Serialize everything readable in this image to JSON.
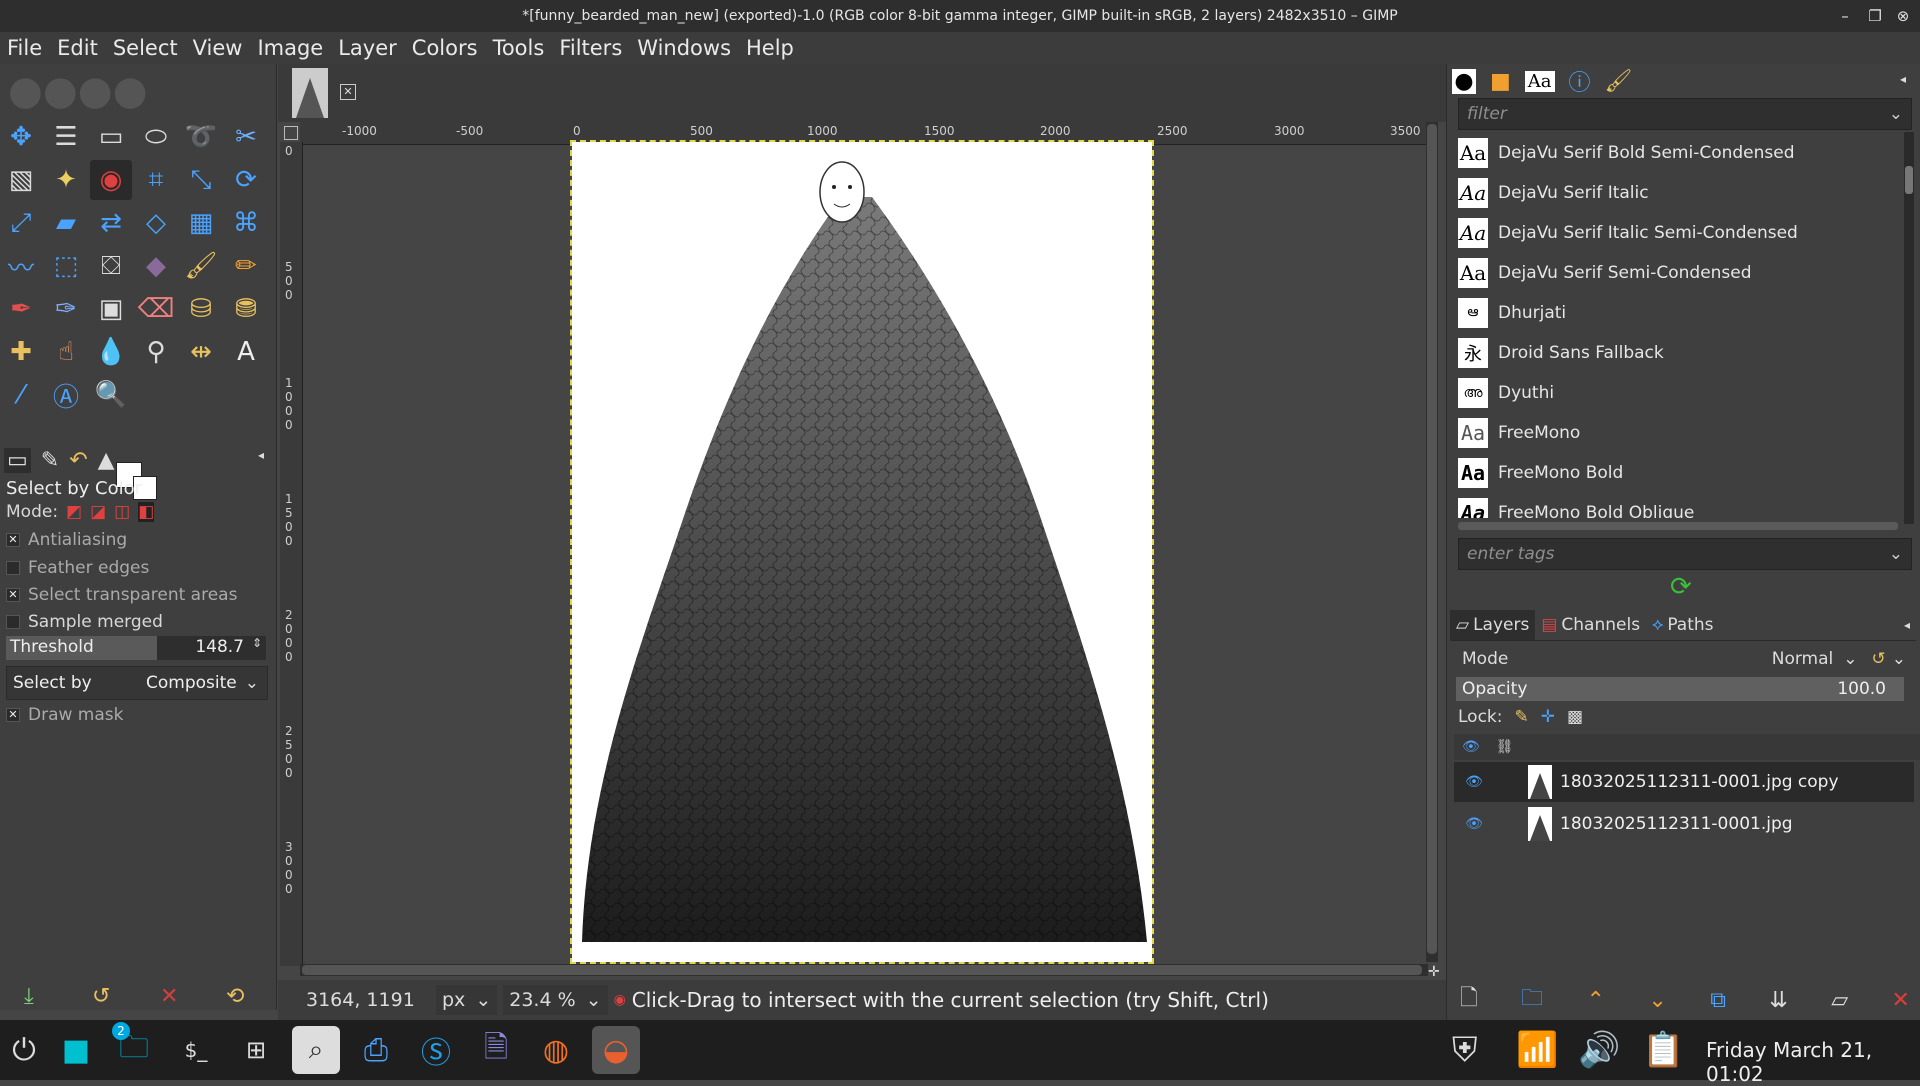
{
  "window": {
    "title": "*[funny_bearded_man_new] (exported)-1.0 (RGB color 8-bit gamma integer, GIMP built-in sRGB, 2 layers) 2482x3510 – GIMP"
  },
  "menu": [
    "File",
    "Edit",
    "Select",
    "View",
    "Image",
    "Layer",
    "Colors",
    "Tools",
    "Filters",
    "Windows",
    "Help"
  ],
  "tool_options": {
    "title": "Select by Color",
    "mode_label": "Mode:",
    "antialiasing": "Antialiasing",
    "feather": "Feather edges",
    "transparent": "Select transparent areas",
    "sample_merged": "Sample merged",
    "threshold_label": "Threshold",
    "threshold_value": "148.7",
    "threshold_fraction": 0.58,
    "select_by_label": "Select by",
    "select_by_value": "Composite",
    "draw_mask": "Draw mask"
  },
  "rulers": {
    "h": [
      "-1000",
      "-500",
      "0",
      "500",
      "1000",
      "1500",
      "2000",
      "2500",
      "3000",
      "3500"
    ],
    "v": [
      "0",
      "500",
      "1000",
      "1500",
      "2000",
      "2500",
      "3000"
    ]
  },
  "status": {
    "coords": "3164, 1191",
    "unit": "px",
    "zoom": "23.4 %",
    "message": "Click-Drag to intersect with the current selection (try Shift, Ctrl)"
  },
  "fonts": {
    "filter_placeholder": "filter",
    "tags_placeholder": "enter tags",
    "items": [
      {
        "name": "DejaVu Serif Bold Semi-Condensed",
        "preview": "Aa"
      },
      {
        "name": "DejaVu Serif Italic",
        "preview": "Aa"
      },
      {
        "name": "DejaVu Serif Italic Semi-Condensed",
        "preview": "Aa"
      },
      {
        "name": "DejaVu Serif Semi-Condensed",
        "preview": "Aa"
      },
      {
        "name": "Dhurjati",
        "preview": "ఆ"
      },
      {
        "name": "Droid Sans Fallback",
        "preview": "永"
      },
      {
        "name": "Dyuthi",
        "preview": "അ"
      },
      {
        "name": "FreeMono",
        "preview": "Aa"
      },
      {
        "name": "FreeMono Bold",
        "preview": "Aa"
      },
      {
        "name": "FreeMono Bold Oblique",
        "preview": "Aa"
      }
    ]
  },
  "layers_panel": {
    "tabs": [
      "Layers",
      "Channels",
      "Paths"
    ],
    "mode_label": "Mode",
    "mode_value": "Normal",
    "opacity_label": "Opacity",
    "opacity_value": "100.0",
    "lock_label": "Lock:",
    "layers": [
      {
        "name": "18032025112311-0001.jpg copy",
        "selected": true
      },
      {
        "name": "18032025112311-0001.jpg",
        "selected": false
      }
    ]
  },
  "taskbar": {
    "clock": "Friday March 21, 01:02",
    "files_badge": "2",
    "icons": [
      "menu-icon",
      "desktop-icon",
      "files-icon",
      "terminal-icon",
      "calculator-icon",
      "search-icon",
      "screenshot-icon",
      "skype-icon",
      "text-editor-icon",
      "firefox-icon",
      "gimp-icon"
    ]
  },
  "colors": {
    "accent_selection": "#e2d64a",
    "delete_red": "#e03c3c",
    "refresh_green": "#38c038"
  }
}
